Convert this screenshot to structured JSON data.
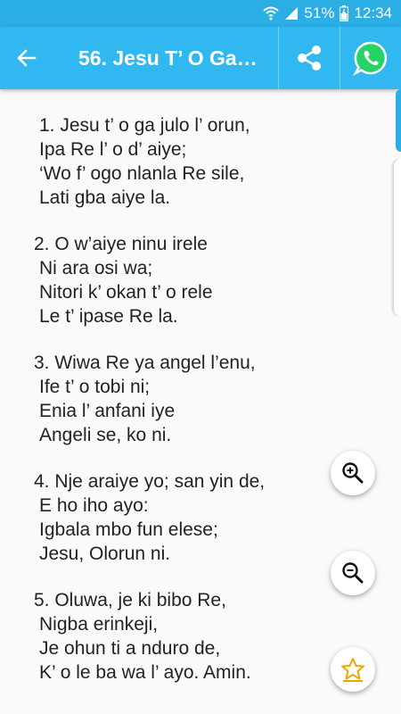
{
  "status_bar": {
    "battery": "51%",
    "time": "12:34",
    "icons": [
      "wifi-icon",
      "signal-icon",
      "battery-icon"
    ]
  },
  "toolbar": {
    "title": "56.  Jesu T’ O Ga…",
    "icons": [
      "back-arrow-icon",
      "share-icon",
      "whatsapp-icon"
    ]
  },
  "verses": [
    {
      "lines": [
        "1. Jesu t’ o ga julo l’ orun,",
        "Ipa Re l’ o d’ aiye;",
        "‘Wo f’ ogo nlanla Re sile,",
        "Lati gba aiye la."
      ]
    },
    {
      "lines": [
        "2. O w’aiye ninu irele",
        "Ni ara osi wa;",
        "Nitori k’ okan t’ o rele",
        "Le t’ ipase Re la."
      ]
    },
    {
      "lines": [
        "3. Wiwa Re ya angel l’enu,",
        "Ife t’ o tobi ni;",
        "Enia l’ anfani iye",
        "Angeli se, ko ni."
      ]
    },
    {
      "lines": [
        "4. Nje araiye yo; san yin de,",
        "E ho iho ayo:",
        "Igbala mbo fun elese;",
        "Jesu, Olorun ni."
      ]
    },
    {
      "lines": [
        "5. Oluwa, je ki bibo Re,",
        "Nigba erinkeji,",
        "Je ohun ti a nduro de,",
        "K’ o le ba wa l’ ayo. Amin."
      ]
    }
  ],
  "fabs": {
    "icons": [
      "zoom-in-icon",
      "zoom-out-icon",
      "star-icon"
    ],
    "accent": "#f0a500"
  },
  "colors": {
    "status_bar": "#2aaee4",
    "toolbar": "#32b8f0",
    "whatsapp": "#25d366",
    "text": "#222222"
  }
}
